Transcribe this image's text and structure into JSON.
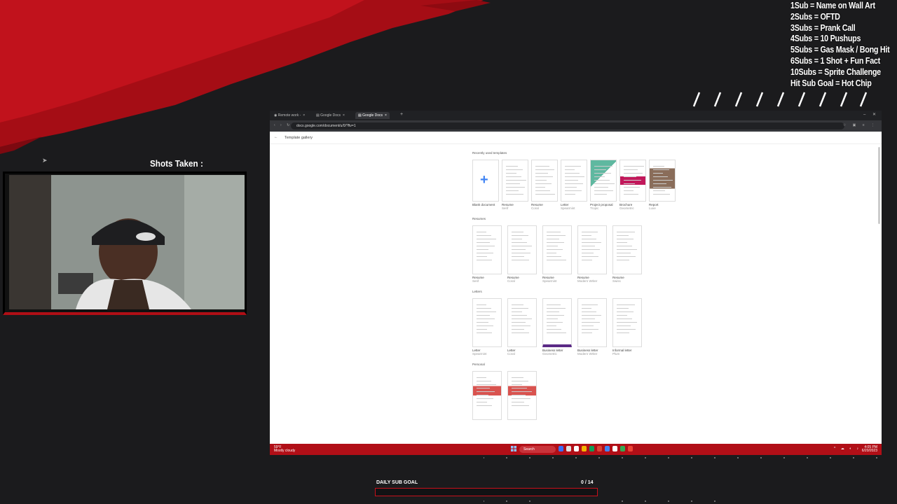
{
  "overlay": {
    "sub_rules": [
      "1Sub = Name on Wall Art",
      "2Subs = OFTD",
      "3Subs = Prank Call",
      "4Subs = 10 Pushups",
      "5Subs = Gas Mask / Bong Hit",
      "6Subs = 1 Shot + Fun Fact",
      "10Subs =  Sprite Challenge",
      "Hit Sub Goal  = Hot Chip"
    ],
    "shots_label": "Shots Taken :",
    "goal_label": "DAILY SUB GOAL",
    "goal_count": "0 / 14",
    "goal_progress": 0,
    "accent_color": "#c8101b"
  },
  "browser": {
    "tabs": [
      {
        "label": "Remote work -",
        "icon": "tab-favicon"
      },
      {
        "label": "Google Docs",
        "icon": "docs-icon"
      },
      {
        "label": "Google Docs",
        "icon": "docs-icon"
      }
    ],
    "url": "docs.google.com/document/u/0/?ftv=1",
    "page_title": "Template gallery"
  },
  "gallery": {
    "sections": [
      {
        "title": "Recently used templates",
        "items": [
          {
            "name": "Blank document",
            "sub": ""
          },
          {
            "name": "Resume",
            "sub": "Serif"
          },
          {
            "name": "Resume",
            "sub": "Coral"
          },
          {
            "name": "Letter",
            "sub": "Spearmint"
          },
          {
            "name": "Project proposal",
            "sub": "Tropic"
          },
          {
            "name": "Brochure",
            "sub": "Geometric"
          },
          {
            "name": "Report",
            "sub": "Luxe"
          }
        ]
      },
      {
        "title": "Resumes",
        "items": [
          {
            "name": "Resume",
            "sub": "Serif"
          },
          {
            "name": "Resume",
            "sub": "Coral"
          },
          {
            "name": "Resume",
            "sub": "Spearmint"
          },
          {
            "name": "Resume",
            "sub": "Modern Writer"
          },
          {
            "name": "Resume",
            "sub": "Swiss"
          }
        ]
      },
      {
        "title": "Letters",
        "items": [
          {
            "name": "Letter",
            "sub": "Spearmint"
          },
          {
            "name": "Letter",
            "sub": "Coral"
          },
          {
            "name": "Business letter",
            "sub": "Geometric"
          },
          {
            "name": "Business letter",
            "sub": "Modern Writer"
          },
          {
            "name": "Informal letter",
            "sub": "Plum"
          }
        ]
      },
      {
        "title": "Personal",
        "items": [
          {
            "name": "",
            "sub": ""
          },
          {
            "name": "",
            "sub": ""
          }
        ]
      }
    ]
  },
  "taskbar": {
    "weather_temp": "59°F",
    "weather_desc": "Mostly cloudy",
    "search_placeholder": "Search",
    "time": "4:05 PM",
    "date": "6/20/2023",
    "app_colors": [
      "#3a6ff7",
      "#e0e0e0",
      "#ffffff",
      "#f4b400",
      "#0f9d58",
      "#db4437",
      "#4285f4",
      "#ffffff",
      "#34a853",
      "#ea4335"
    ]
  }
}
